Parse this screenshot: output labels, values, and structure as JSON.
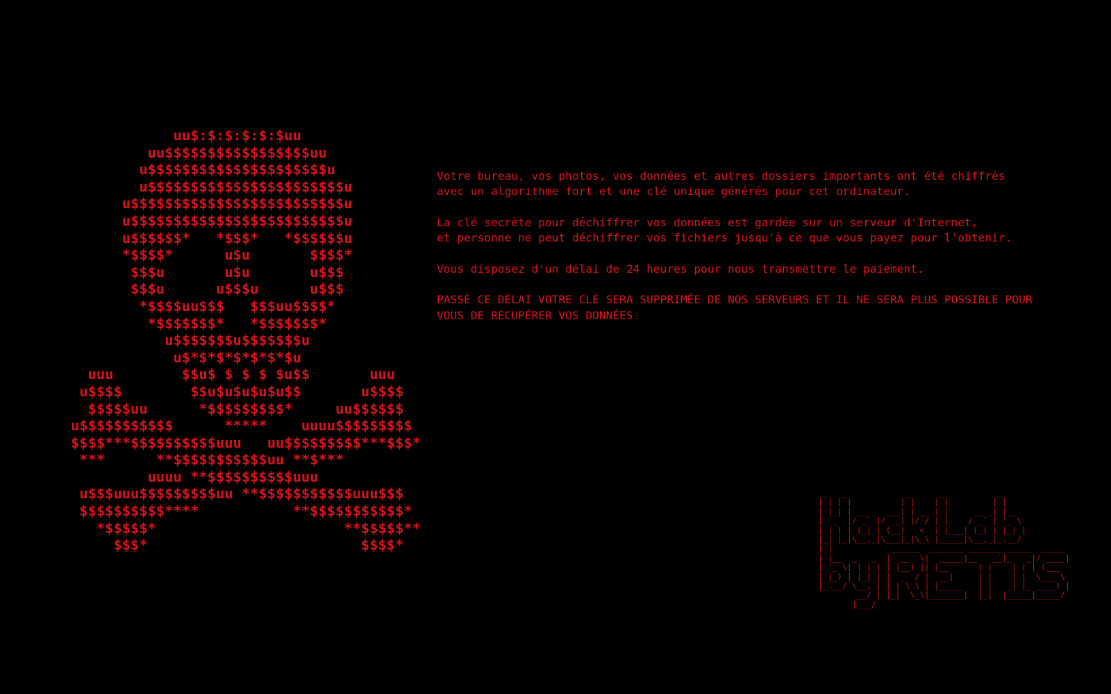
{
  "colors": {
    "background": "#000000",
    "text_red": "#e0141b"
  },
  "skull_art": "            uu$:$:$:$:$:$uu\n         uu$$$$$$$$$$$$$$$$$uu\n        u$$$$$$$$$$$$$$$$$$$$$u\n        u$$$$$$$$$$$$$$$$$$$$$$$u\n      u$$$$$$$$$$$$$$$$$$$$$$$$$u\n      u$$$$$$$$$$$$$$$$$$$$$$$$$u\n      u$$$$$$*   *$$$*   *$$$$$$u\n      *$$$$*      u$u       $$$$*\n       $$$u       u$u       u$$$\n       $$$u      u$$$u      u$$$\n        *$$$$uu$$$   $$$uu$$$$*\n         *$$$$$$$*   *$$$$$$$*\n           u$$$$$$$u$$$$$$$u\n            u$*$*$*$*$*$*$u\n  uuu        $$u$ $ $ $ $u$$       uuu\n u$$$$        $$u$u$u$u$u$$       u$$$$\n  $$$$$uu      *$$$$$$$$$*     uu$$$$$$\nu$$$$$$$$$$$      *****    uuuu$$$$$$$$$\n$$$$***$$$$$$$$$$uuu   uu$$$$$$$$$***$$$*\n ***      **$$$$$$$$$$$uu **$***\n         uuuu **$$$$$$$$$$uuu\n u$$$uuu$$$$$$$$$uu **$$$$$$$$$$$uuu$$$\n $$$$$$$$$$****           **$$$$$$$$$$$*\n   *$$$$$*                      **$$$$$**\n     $$$*                         $$$$*",
  "message": {
    "paragraph_1": "Votre bureau, vos photos, vos données et autres dossiers importants ont été chiffrés\navec un algorithme fort et une clé unique générés pour cet ordinateur.",
    "paragraph_2": "La clé secrète pour déchiffrer vos données est gardée sur un serveur d'Internet,\net personne ne peut déchiffrer vos fichiers jusqu'à ce que vous payez pour l'obtenir.",
    "paragraph_3": "Vous disposez d'un délai de 24 heures pour nous transmettre le paiement.",
    "paragraph_4": "PASSÉ CE DÉLAI VOTRE CLÉ SERA SUPPRIMÉE DE NOS SERVEURS ET IL NE SERA PLUS POSSIBLE POUR\nVOUS DE RÉCUPÉRER VOS DONNÉES"
  },
  "logo": {
    "text": "Hack Lab by RETIS",
    "art": " _   _            _      _           _\n| | | |          | |    | |         | |\n| |_| | __ _  ___| | __ | |     __ _| |__\n|  _  |/ _` |/ __| |/ / | |    / _` | '_ \\\n| | | | (_| | (__|   <  | |___| (_| | |_) |\n|_| |_|\\__,_|\\___|_|\\_\\ |_____|\\__,_|_.__/\n| |            ______  _______ _______ _____  _____\n| |__  _   _  |  __  \\|  _____|__   __|_   _|/ ____|\n| '_ \\| | | | | |__) || |__      | |    | | | (___\n| |_) | |_| | |  _  / |  __|     | |    | |  \\___ \\\n|_.__/ \\__, | | | \\ \\ | |_____   | |   _| |_ ____) |\n        __/ | |_|  \\_\\|_______|  |_|  |_____|_____/\n       |___/"
  }
}
